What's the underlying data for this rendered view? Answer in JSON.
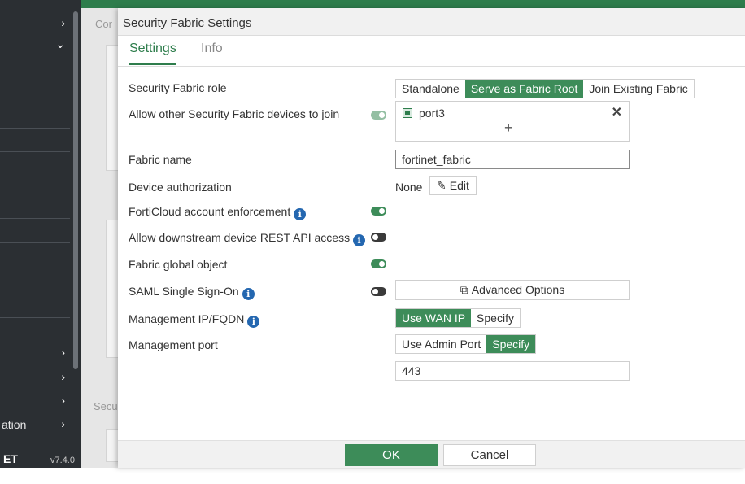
{
  "sidebar": {
    "partial_item_label": "ation",
    "logo_text": "ET",
    "version": "v7.4.0"
  },
  "background_page": {
    "partial_heading_top": "Cor",
    "partial_heading_bottom": "Secu"
  },
  "dialog": {
    "title": "Security Fabric Settings",
    "tabs": [
      {
        "label": "Settings",
        "active": true
      },
      {
        "label": "Info",
        "active": false
      }
    ],
    "fields": {
      "role": {
        "label": "Security Fabric role",
        "options": [
          "Standalone",
          "Serve as Fabric Root",
          "Join Existing Fabric"
        ],
        "selected": "Serve as Fabric Root"
      },
      "allow_join": {
        "label": "Allow other Security Fabric devices to join",
        "enabled": true,
        "interfaces": [
          "port3"
        ],
        "add_symbol": "+",
        "remove_symbol": "✕"
      },
      "fabric_name": {
        "label": "Fabric name",
        "value": "fortinet_fabric"
      },
      "device_authorization": {
        "label": "Device authorization",
        "value": "None",
        "edit_label": "Edit"
      },
      "forticloud_enforcement": {
        "label": "FortiCloud account enforcement",
        "enabled": true
      },
      "downstream_rest_api": {
        "label": "Allow downstream device REST API access",
        "enabled": false
      },
      "global_object": {
        "label": "Fabric global object",
        "enabled": true
      },
      "saml_sso": {
        "label": "SAML Single Sign-On",
        "enabled": false,
        "advanced_label": "Advanced Options"
      },
      "management_ip": {
        "label": "Management IP/FQDN",
        "options": [
          "Use WAN IP",
          "Specify"
        ],
        "selected": "Use WAN IP"
      },
      "management_port": {
        "label": "Management port",
        "options": [
          "Use Admin Port",
          "Specify"
        ],
        "selected": "Specify",
        "value": "443"
      }
    },
    "footer": {
      "ok_label": "OK",
      "cancel_label": "Cancel"
    }
  },
  "colors": {
    "accent_green": "#3d8c59",
    "info_blue": "#2467b0",
    "sidebar_bg": "#2b2f33"
  },
  "icons": {
    "info": "info-icon",
    "edit": "pencil-icon",
    "external": "external-link-icon",
    "port": "ethernet-port-icon"
  }
}
